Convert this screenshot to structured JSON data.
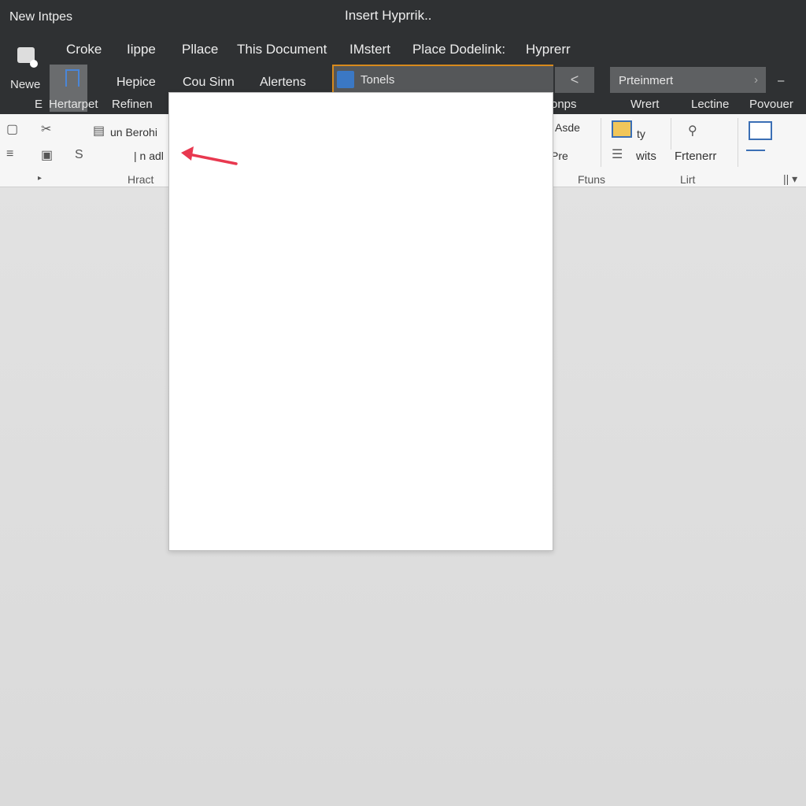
{
  "window": {
    "app_title": "New Intpes",
    "dialog_title": "Insert Hyprrik.."
  },
  "tabs_row1": [
    "Croke",
    "Iippe",
    "Pllace",
    "This Document",
    "IMstert",
    "Place Dodelink:",
    "Hyprerr"
  ],
  "tabs_row2": [
    "Hepice",
    "Cou Sinn",
    "Alertens"
  ],
  "left": {
    "new_label": "Newe",
    "e_label": "E",
    "hertarpet": "Hertarpet",
    "refinen": "Refinen"
  },
  "tonels_field": {
    "value": "Tonels"
  },
  "row3": {
    "onps": "onps",
    "wrert": "Wrert",
    "lectine": "Lectine",
    "povouer": "Povouer"
  },
  "search_field": {
    "value": "Prteinmert"
  },
  "ribbon": {
    "run_label": "un Berohi",
    "nadl_label": "| n adl",
    "asde": "Asde",
    "pres": "Pre",
    "ty": "ty",
    "wits": "wits",
    "frtenerr": "Frtenerr",
    "groups": [
      "Hract",
      "Ftuns",
      "Lirt"
    ]
  },
  "colors": {
    "accent": "#d88a1c",
    "arrow": "#e8384f",
    "dark_bar": "#2f3133"
  }
}
